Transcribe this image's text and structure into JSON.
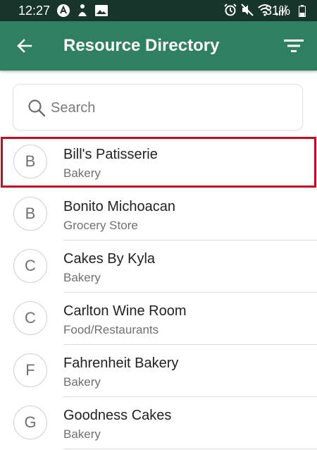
{
  "status_bar": {
    "time": "12:27",
    "battery_percent": "31%",
    "icons_left": [
      "app-a-icon",
      "notification-icon",
      "image-icon"
    ],
    "icons_right": [
      "alarm-icon",
      "mute-icon",
      "wifi-icon",
      "signal-icon",
      "battery-icon"
    ]
  },
  "header": {
    "title": "Resource Directory",
    "back_icon": "back-arrow-icon",
    "filter_icon": "filter-icon",
    "color": "#2f8060"
  },
  "search": {
    "placeholder": "Search",
    "value": ""
  },
  "list": {
    "selected_index": 0,
    "highlight_color": "#c00c25",
    "items": [
      {
        "initial": "B",
        "name": "Bill's Patisserie",
        "category": "Bakery"
      },
      {
        "initial": "B",
        "name": "Bonito Michoacan",
        "category": "Grocery Store"
      },
      {
        "initial": "C",
        "name": "Cakes By Kyla",
        "category": "Bakery"
      },
      {
        "initial": "C",
        "name": "Carlton Wine Room",
        "category": "Food/Restaurants"
      },
      {
        "initial": "F",
        "name": "Fahrenheit Bakery",
        "category": "Bakery"
      },
      {
        "initial": "G",
        "name": "Goodness Cakes",
        "category": "Bakery"
      }
    ]
  }
}
